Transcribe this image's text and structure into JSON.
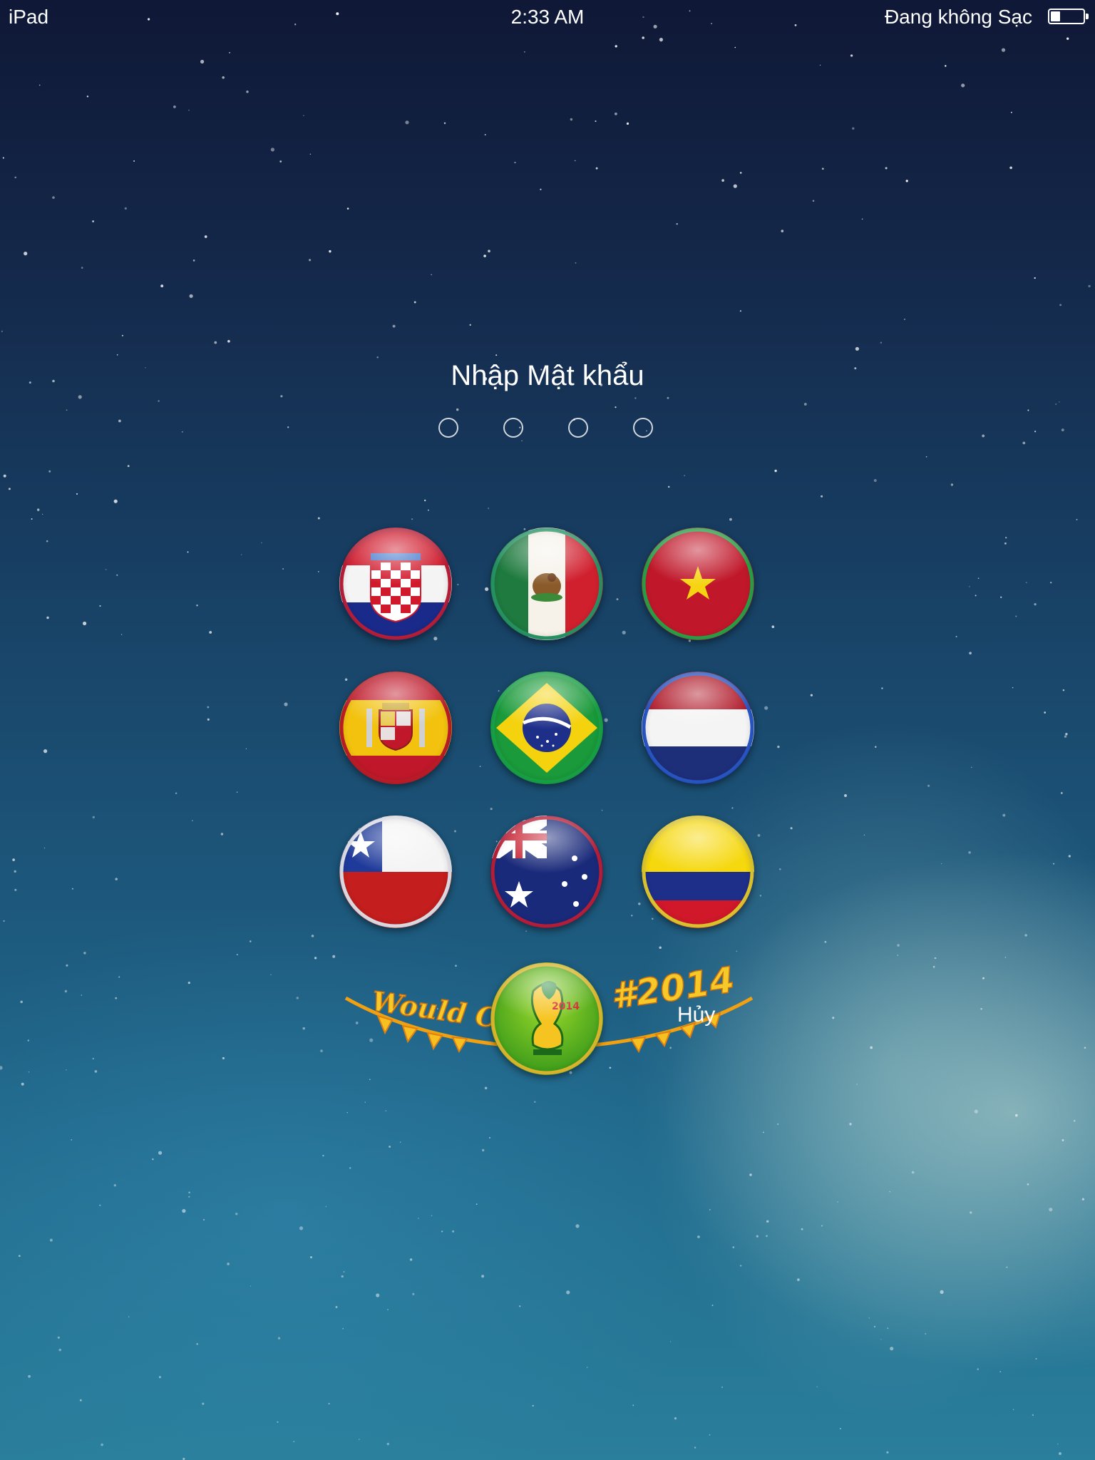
{
  "status_bar": {
    "device": "iPad",
    "time": "2:33 AM",
    "charging_status": "Đang không Sạc",
    "battery_level": 0.3
  },
  "passcode": {
    "prompt": "Nhập Mật khẩu",
    "digits_total": 4,
    "digits_entered": 0
  },
  "keypad": {
    "keys": [
      {
        "flag": "Croatia",
        "ring_color": "#c0203a"
      },
      {
        "flag": "Mexico",
        "ring_color": "#2a9a6a"
      },
      {
        "flag": "Vietnam",
        "ring_color": "#2aa84a"
      },
      {
        "flag": "Spain",
        "ring_color": "#c41e2a"
      },
      {
        "flag": "Brazil",
        "ring_color": "#1aa84a"
      },
      {
        "flag": "Netherlands",
        "ring_color": "#2a5acc"
      },
      {
        "flag": "Chile",
        "ring_color": "#e8e8f0"
      },
      {
        "flag": "Australia",
        "ring_color": "#c0203a"
      },
      {
        "flag": "Colombia",
        "ring_color": "#e8d030"
      }
    ],
    "zero_key": {
      "icon": "world-cup-2014-logo"
    }
  },
  "banner": {
    "left_text": "Would Cub",
    "right_text": "#2014",
    "emblem_text": "2014"
  },
  "cancel_label": "Hủy"
}
